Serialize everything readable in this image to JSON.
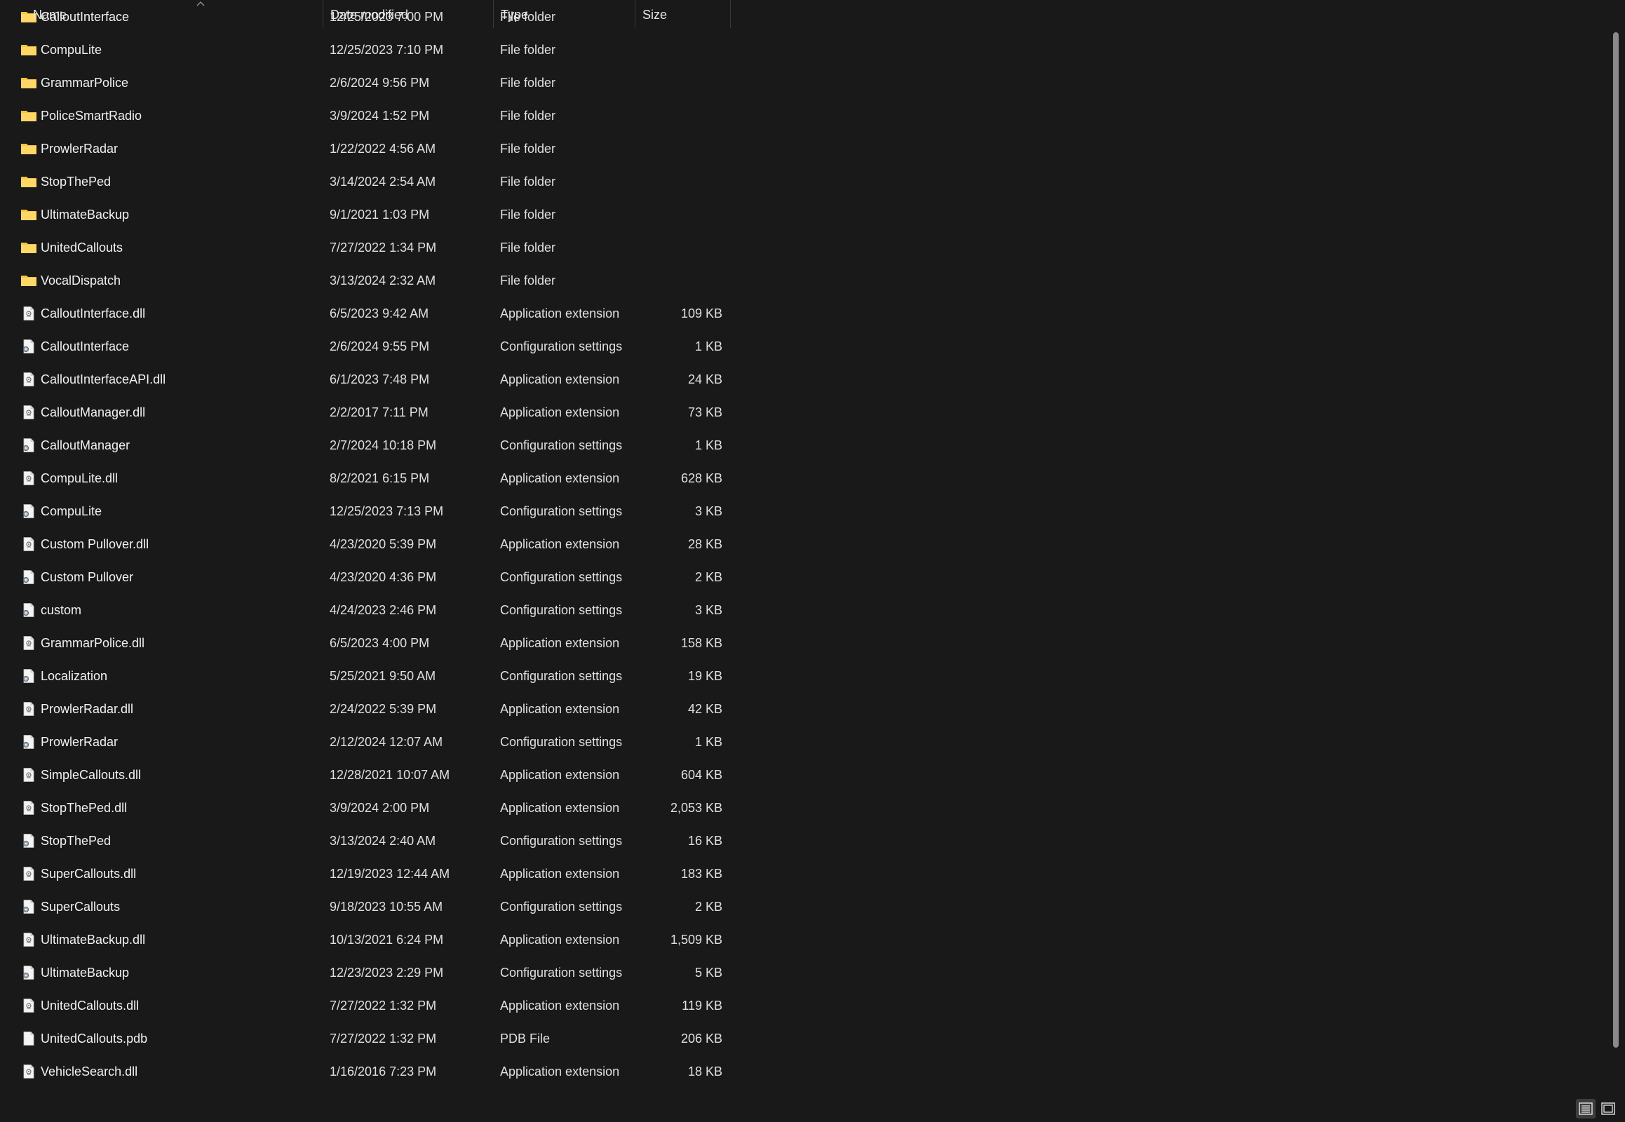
{
  "columns": {
    "name": "Name",
    "date": "Date modified",
    "type": "Type",
    "size": "Size"
  },
  "files": [
    {
      "name": "CalloutInterface",
      "date": "12/25/2023 7:00 PM",
      "type": "File folder",
      "size": "",
      "icon": "folder-icon"
    },
    {
      "name": "CompuLite",
      "date": "12/25/2023 7:10 PM",
      "type": "File folder",
      "size": "",
      "icon": "folder-icon"
    },
    {
      "name": "GrammarPolice",
      "date": "2/6/2024 9:56 PM",
      "type": "File folder",
      "size": "",
      "icon": "folder-icon"
    },
    {
      "name": "PoliceSmartRadio",
      "date": "3/9/2024 1:52 PM",
      "type": "File folder",
      "size": "",
      "icon": "folder-icon"
    },
    {
      "name": "ProwlerRadar",
      "date": "1/22/2022 4:56 AM",
      "type": "File folder",
      "size": "",
      "icon": "folder-icon"
    },
    {
      "name": "StopThePed",
      "date": "3/14/2024 2:54 AM",
      "type": "File folder",
      "size": "",
      "icon": "folder-icon"
    },
    {
      "name": "UltimateBackup",
      "date": "9/1/2021 1:03 PM",
      "type": "File folder",
      "size": "",
      "icon": "folder-icon"
    },
    {
      "name": "UnitedCallouts",
      "date": "7/27/2022 1:34 PM",
      "type": "File folder",
      "size": "",
      "icon": "folder-icon"
    },
    {
      "name": "VocalDispatch",
      "date": "3/13/2024 2:32 AM",
      "type": "File folder",
      "size": "",
      "icon": "folder-icon"
    },
    {
      "name": "CalloutInterface.dll",
      "date": "6/5/2023 9:42 AM",
      "type": "Application extension",
      "size": "109 KB",
      "icon": "dll-file-icon"
    },
    {
      "name": "CalloutInterface",
      "date": "2/6/2024 9:55 PM",
      "type": "Configuration settings",
      "size": "1 KB",
      "icon": "config-file-icon"
    },
    {
      "name": "CalloutInterfaceAPI.dll",
      "date": "6/1/2023 7:48 PM",
      "type": "Application extension",
      "size": "24 KB",
      "icon": "dll-file-icon"
    },
    {
      "name": "CalloutManager.dll",
      "date": "2/2/2017 7:11 PM",
      "type": "Application extension",
      "size": "73 KB",
      "icon": "dll-file-icon"
    },
    {
      "name": "CalloutManager",
      "date": "2/7/2024 10:18 PM",
      "type": "Configuration settings",
      "size": "1 KB",
      "icon": "config-file-icon"
    },
    {
      "name": "CompuLite.dll",
      "date": "8/2/2021 6:15 PM",
      "type": "Application extension",
      "size": "628 KB",
      "icon": "dll-file-icon"
    },
    {
      "name": "CompuLite",
      "date": "12/25/2023 7:13 PM",
      "type": "Configuration settings",
      "size": "3 KB",
      "icon": "config-file-icon"
    },
    {
      "name": "Custom Pullover.dll",
      "date": "4/23/2020 5:39 PM",
      "type": "Application extension",
      "size": "28 KB",
      "icon": "dll-file-icon"
    },
    {
      "name": "Custom Pullover",
      "date": "4/23/2020 4:36 PM",
      "type": "Configuration settings",
      "size": "2 KB",
      "icon": "config-file-icon"
    },
    {
      "name": "custom",
      "date": "4/24/2023 2:46 PM",
      "type": "Configuration settings",
      "size": "3 KB",
      "icon": "config-file-icon"
    },
    {
      "name": "GrammarPolice.dll",
      "date": "6/5/2023 4:00 PM",
      "type": "Application extension",
      "size": "158 KB",
      "icon": "dll-file-icon"
    },
    {
      "name": "Localization",
      "date": "5/25/2021 9:50 AM",
      "type": "Configuration settings",
      "size": "19 KB",
      "icon": "config-file-icon"
    },
    {
      "name": "ProwlerRadar.dll",
      "date": "2/24/2022 5:39 PM",
      "type": "Application extension",
      "size": "42 KB",
      "icon": "dll-file-icon"
    },
    {
      "name": "ProwlerRadar",
      "date": "2/12/2024 12:07 AM",
      "type": "Configuration settings",
      "size": "1 KB",
      "icon": "config-file-icon"
    },
    {
      "name": "SimpleCallouts.dll",
      "date": "12/28/2021 10:07 AM",
      "type": "Application extension",
      "size": "604 KB",
      "icon": "dll-file-icon"
    },
    {
      "name": "StopThePed.dll",
      "date": "3/9/2024 2:00 PM",
      "type": "Application extension",
      "size": "2,053 KB",
      "icon": "dll-file-icon"
    },
    {
      "name": "StopThePed",
      "date": "3/13/2024 2:40 AM",
      "type": "Configuration settings",
      "size": "16 KB",
      "icon": "config-file-icon"
    },
    {
      "name": "SuperCallouts.dll",
      "date": "12/19/2023 12:44 AM",
      "type": "Application extension",
      "size": "183 KB",
      "icon": "dll-file-icon"
    },
    {
      "name": "SuperCallouts",
      "date": "9/18/2023 10:55 AM",
      "type": "Configuration settings",
      "size": "2 KB",
      "icon": "config-file-icon"
    },
    {
      "name": "UltimateBackup.dll",
      "date": "10/13/2021 6:24 PM",
      "type": "Application extension",
      "size": "1,509 KB",
      "icon": "dll-file-icon"
    },
    {
      "name": "UltimateBackup",
      "date": "12/23/2023 2:29 PM",
      "type": "Configuration settings",
      "size": "5 KB",
      "icon": "config-file-icon"
    },
    {
      "name": "UnitedCallouts.dll",
      "date": "7/27/2022 1:32 PM",
      "type": "Application extension",
      "size": "119 KB",
      "icon": "dll-file-icon"
    },
    {
      "name": "UnitedCallouts.pdb",
      "date": "7/27/2022 1:32 PM",
      "type": "PDB File",
      "size": "206 KB",
      "icon": "blank-file-icon"
    },
    {
      "name": "VehicleSearch.dll",
      "date": "1/16/2016 7:23 PM",
      "type": "Application extension",
      "size": "18 KB",
      "icon": "dll-file-icon"
    }
  ],
  "colors": {
    "background": "#191919",
    "folder": "#f5c542",
    "text": "#f2f2f2"
  }
}
